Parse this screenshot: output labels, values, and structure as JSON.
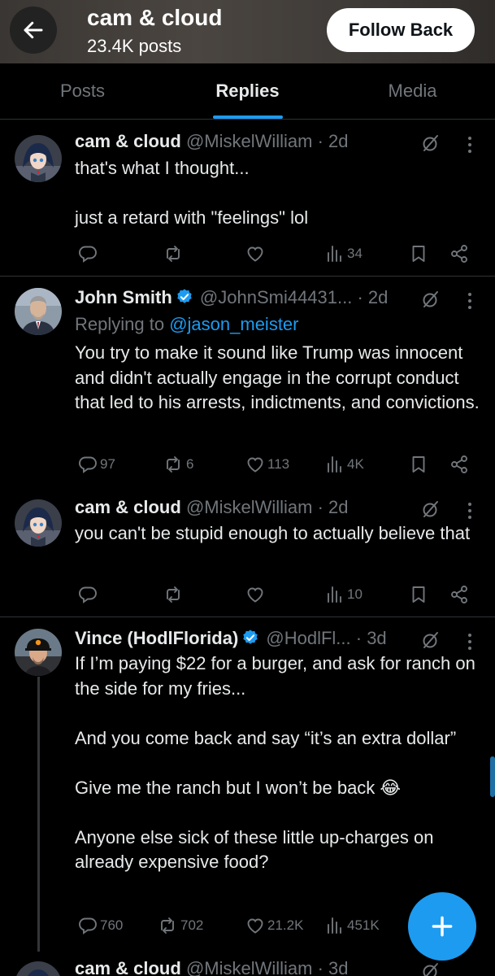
{
  "header": {
    "name": "cam & cloud",
    "posts": "23.4K posts",
    "follow_label": "Follow Back"
  },
  "tabs": [
    {
      "label": "Posts",
      "active": false
    },
    {
      "label": "Replies",
      "active": true
    },
    {
      "label": "Media",
      "active": false
    }
  ],
  "tweets": [
    {
      "name": "cam & cloud",
      "handle_time": "@MiskelWilliam · 2d",
      "verified": false,
      "text": "that's what I thought...\n\njust a retard with \"feelings\"  lol",
      "views": "34"
    },
    {
      "name": "John Smith",
      "handle_time": "@JohnSmi44431... · 2d",
      "verified": true,
      "replying_prefix": "Replying to",
      "replying_to": "@jason_meister",
      "text": "You try to make it sound like Trump was innocent and didn't actually engage in the corrupt conduct that led to his arrests, indictments, and convictions.",
      "replies": "97",
      "reposts": "6",
      "likes": "113",
      "views": "4K"
    },
    {
      "name": "cam & cloud",
      "handle_time": "@MiskelWilliam · 2d",
      "verified": false,
      "text": "you can't be stupid enough to actually believe that",
      "views": "10"
    },
    {
      "name": "Vince (HodlFlorida)",
      "handle_time": "@HodlFl... · 3d",
      "verified": true,
      "text": "If I’m paying $22 for a burger, and ask for ranch on the side for my fries...\n\nAnd you come back and say “it’s an extra dollar”\n\nGive me the ranch but I won’t be back 😂\n\nAnyone else sick of these little up-charges on already expensive food?",
      "replies": "760",
      "reposts": "702",
      "likes": "21.2K",
      "views": "451K"
    },
    {
      "name": "cam & cloud",
      "handle_time": "@MiskelWilliam · 3d"
    }
  ],
  "icons": {
    "back": "arrow-left-icon",
    "reply": "comment-icon",
    "repost": "repost-icon",
    "like": "heart-icon",
    "views": "views-icon",
    "bookmark": "bookmark-icon",
    "share": "share-icon",
    "grok": "grok-icon",
    "more": "more-vertical-icon",
    "compose": "plus-icon"
  },
  "colors": {
    "accent": "#1d9bf0",
    "muted": "#71767b",
    "background": "#000000"
  }
}
